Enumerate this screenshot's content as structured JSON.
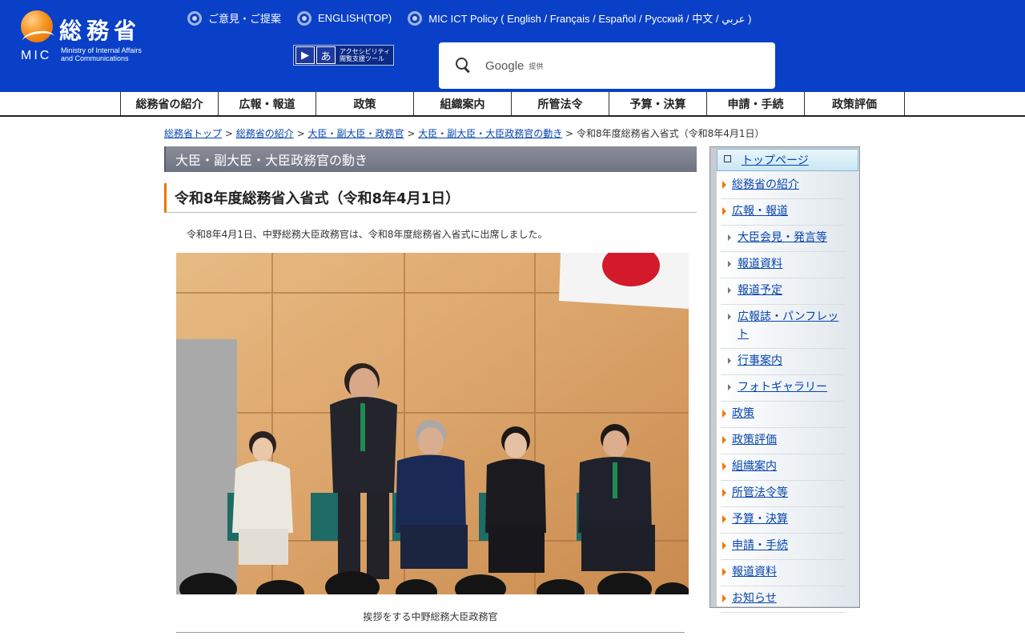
{
  "header": {
    "logo_jp": "総務省",
    "logo_mic": "MIC",
    "logo_en_line1": "Ministry of Internal Affairs",
    "logo_en_line2": "and Communications",
    "top_links": [
      {
        "label": "ご意見・ご提案"
      },
      {
        "label": "ENGLISH(TOP)"
      },
      {
        "label": "MIC ICT Policy ( English / Français / Español / Русский / 中文 / عربي )"
      }
    ],
    "a11y_text_line1": "アクセシビリティ",
    "a11y_text_line2": "閲覧支援ツール",
    "search": {
      "brand": "Google",
      "powered": "提供"
    }
  },
  "nav": {
    "items": [
      "総務省の紹介",
      "広報・報道",
      "政策",
      "組織案内",
      "所管法令",
      "予算・決算",
      "申請・手続",
      "政策評価"
    ]
  },
  "breadcrumb": {
    "links": [
      "総務省トップ",
      "総務省の紹介",
      "大臣・副大臣・政務官",
      "大臣・副大臣・大臣政務官の動き"
    ],
    "separator": ">",
    "current": "令和8年度総務省入省式（令和8年4月1日）"
  },
  "main": {
    "section_title": "大臣・副大臣・大臣政務官の動き",
    "page_title": "令和8年度総務省入省式（令和8年4月1日）",
    "lead": "令和8年4月1日、中野総務大臣政務官は、令和8年度総務省入省式に出席しました。",
    "caption": "挨拶をする中野総務大臣政務官"
  },
  "sidebar": {
    "top": "トップページ",
    "items": [
      {
        "label": "総務省の紹介",
        "level": 1
      },
      {
        "label": "広報・報道",
        "level": 1
      },
      {
        "label": "大臣会見・発言等",
        "level": 2
      },
      {
        "label": "報道資料",
        "level": 2
      },
      {
        "label": "報道予定",
        "level": 2
      },
      {
        "label": "広報誌・パンフレット",
        "level": 2
      },
      {
        "label": "行事案内",
        "level": 2
      },
      {
        "label": "フォトギャラリー",
        "level": 2
      },
      {
        "label": "政策",
        "level": 1
      },
      {
        "label": "政策評価",
        "level": 1
      },
      {
        "label": "組織案内",
        "level": 1
      },
      {
        "label": "所管法令等",
        "level": 1
      },
      {
        "label": "予算・決算",
        "level": 1
      },
      {
        "label": "申請・手続",
        "level": 1
      },
      {
        "label": "報道資料",
        "level": 1
      },
      {
        "label": "お知らせ",
        "level": 1
      }
    ]
  },
  "colors": {
    "header_bg": "#0a40c7",
    "accent_orange": "#e87800",
    "link": "#0645ad"
  }
}
